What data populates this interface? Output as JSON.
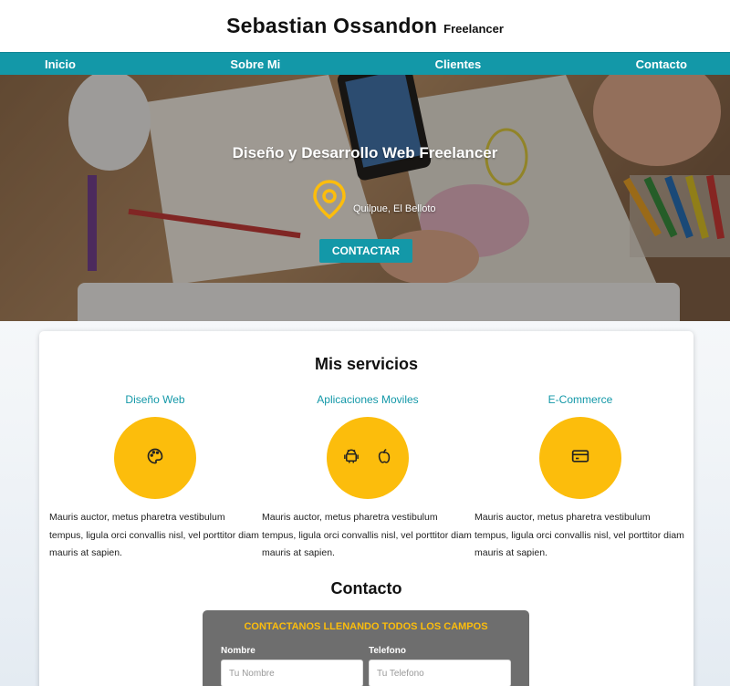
{
  "header": {
    "title": "Sebastian Ossandon",
    "subtitle": "Freelancer"
  },
  "nav": {
    "items": [
      "Inicio",
      "Sobre Mi",
      "Clientes",
      "Contacto"
    ]
  },
  "hero": {
    "title": "Diseño y Desarrollo Web Freelancer",
    "location": "Quilpue, El Belloto",
    "cta_label": "CONTACTAR",
    "icon": "location-pin-icon"
  },
  "services": {
    "title": "Mis servicios",
    "items": [
      {
        "name": "Diseño Web",
        "icons": [
          "palette-icon"
        ],
        "description": "Mauris auctor, metus pharetra vestibulum tempus, ligula orci convallis nisl, vel porttitor diam mauris at sapien."
      },
      {
        "name": "Aplicaciones Moviles",
        "icons": [
          "android-icon",
          "apple-icon"
        ],
        "description": "Mauris auctor, metus pharetra vestibulum tempus, ligula orci convallis nisl, vel porttitor diam mauris at sapien."
      },
      {
        "name": "E-Commerce",
        "icons": [
          "credit-card-icon"
        ],
        "description": "Mauris auctor, metus pharetra vestibulum tempus, ligula orci convallis nisl, vel porttitor diam mauris at sapien."
      }
    ]
  },
  "contact": {
    "title": "Contacto",
    "form_heading": "CONTACTANOS LLENANDO TODOS LOS CAMPOS",
    "name_label": "Nombre",
    "name_placeholder": "Tu Nombre",
    "phone_label": "Telefono",
    "phone_placeholder": "Tu Telefono"
  },
  "colors": {
    "accent": "#1398a8",
    "yellow": "#fcbd0c",
    "form_bg": "#6e6e6e"
  }
}
